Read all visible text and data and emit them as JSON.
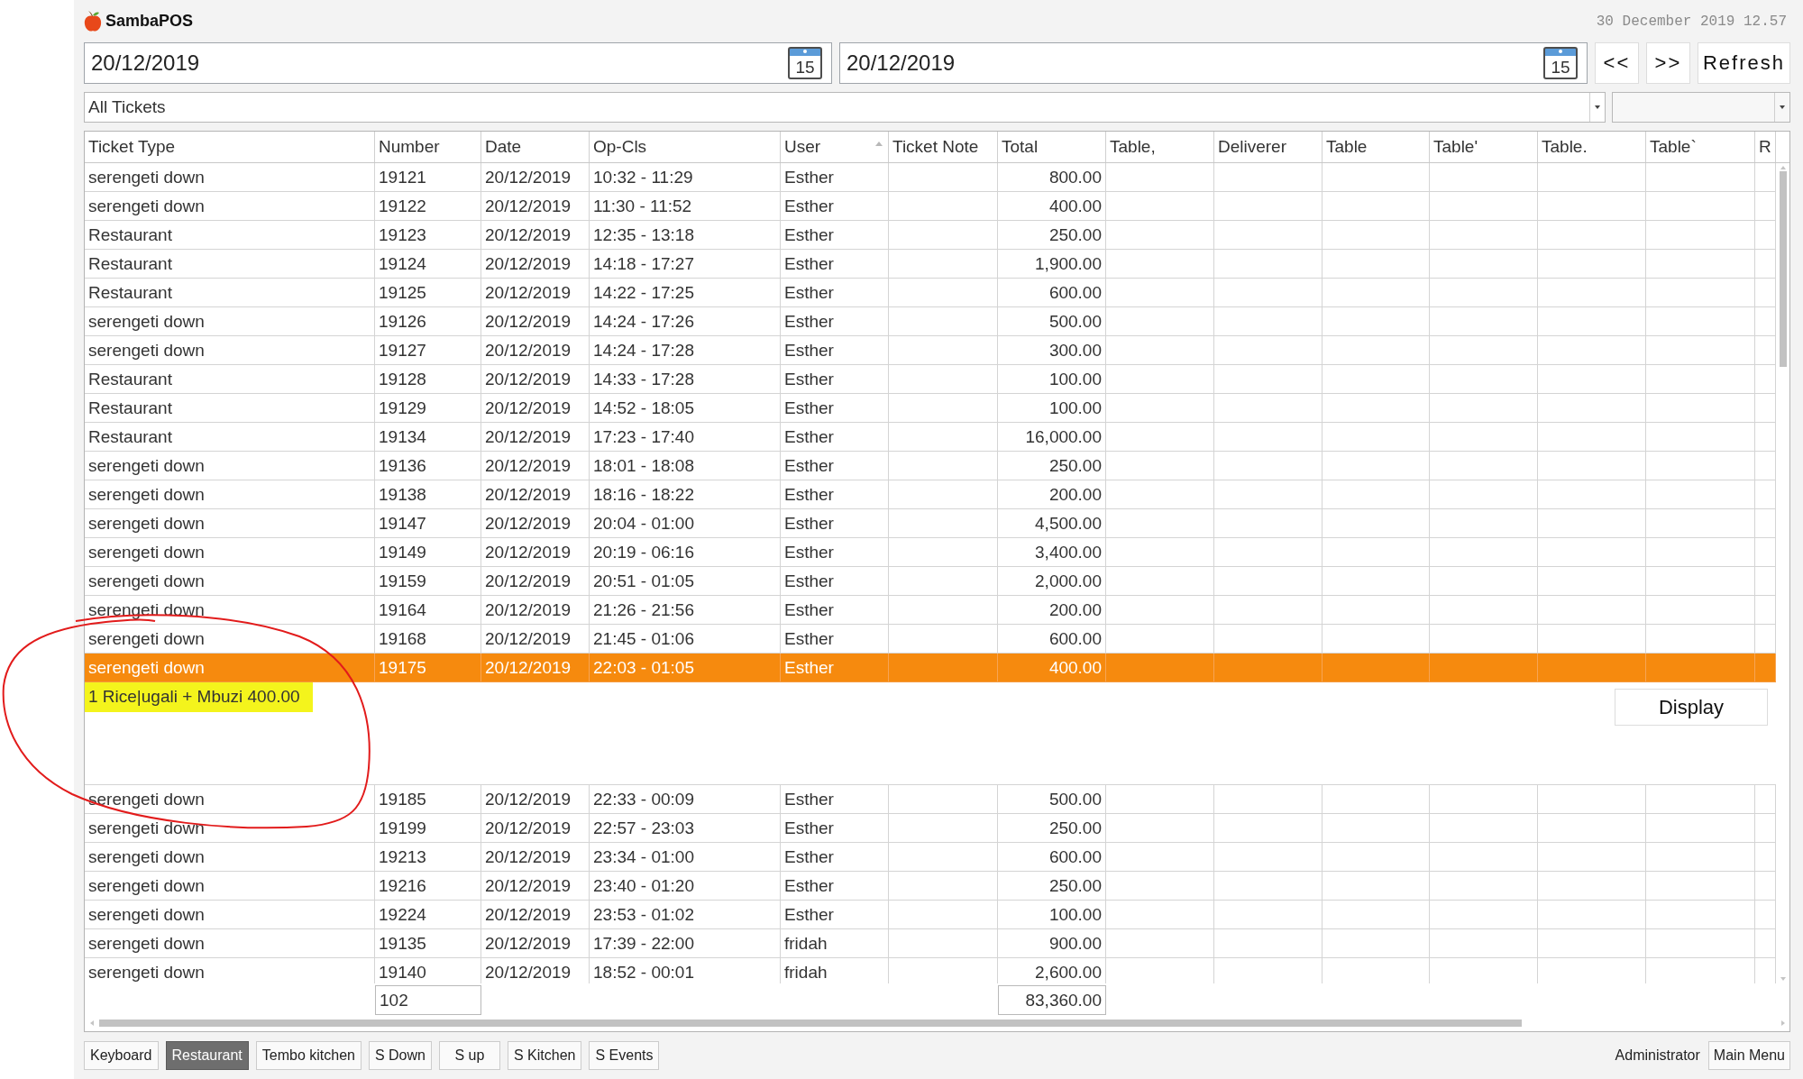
{
  "app": {
    "name": "SambaPOS",
    "clock": "30 December 2019 12.57"
  },
  "date_fields": [
    {
      "value": "20/12/2019",
      "calendar_label": "15"
    },
    {
      "value": "20/12/2019",
      "calendar_label": "15"
    }
  ],
  "nav_buttons": [
    {
      "label": "<<"
    },
    {
      "label": ">>"
    },
    {
      "label": "Refresh"
    }
  ],
  "ticket_filter": {
    "value": "All Tickets"
  },
  "table": {
    "columns": [
      {
        "label": "Ticket Type",
        "sorted": false
      },
      {
        "label": "Number",
        "sorted": false
      },
      {
        "label": "Date",
        "sorted": false
      },
      {
        "label": "Op-Cls",
        "sorted": false
      },
      {
        "label": "User",
        "sorted": true
      },
      {
        "label": "Ticket Note",
        "sorted": false
      },
      {
        "label": "Total",
        "sorted": false
      },
      {
        "label": "Table,",
        "sorted": false
      },
      {
        "label": "Deliverer",
        "sorted": false
      },
      {
        "label": "Table",
        "sorted": false
      },
      {
        "label": "Table'",
        "sorted": false
      },
      {
        "label": "Table.",
        "sorted": false
      },
      {
        "label": "Table`",
        "sorted": false
      },
      {
        "label": "R",
        "sorted": false
      }
    ],
    "rows": [
      {
        "ticket_type": "serengeti down",
        "number": "19121",
        "date": "20/12/2019",
        "op_cls": "10:32 - 11:29",
        "user": "Esther",
        "total": "800.00",
        "selected": false
      },
      {
        "ticket_type": "serengeti down",
        "number": "19122",
        "date": "20/12/2019",
        "op_cls": "11:30 - 11:52",
        "user": "Esther",
        "total": "400.00",
        "selected": false
      },
      {
        "ticket_type": "Restaurant",
        "number": "19123",
        "date": "20/12/2019",
        "op_cls": "12:35 - 13:18",
        "user": "Esther",
        "total": "250.00",
        "selected": false
      },
      {
        "ticket_type": "Restaurant",
        "number": "19124",
        "date": "20/12/2019",
        "op_cls": "14:18 - 17:27",
        "user": "Esther",
        "total": "1,900.00",
        "selected": false
      },
      {
        "ticket_type": "Restaurant",
        "number": "19125",
        "date": "20/12/2019",
        "op_cls": "14:22 - 17:25",
        "user": "Esther",
        "total": "600.00",
        "selected": false
      },
      {
        "ticket_type": "serengeti down",
        "number": "19126",
        "date": "20/12/2019",
        "op_cls": "14:24 - 17:26",
        "user": "Esther",
        "total": "500.00",
        "selected": false
      },
      {
        "ticket_type": "serengeti down",
        "number": "19127",
        "date": "20/12/2019",
        "op_cls": "14:24 - 17:28",
        "user": "Esther",
        "total": "300.00",
        "selected": false
      },
      {
        "ticket_type": "Restaurant",
        "number": "19128",
        "date": "20/12/2019",
        "op_cls": "14:33 - 17:28",
        "user": "Esther",
        "total": "100.00",
        "selected": false
      },
      {
        "ticket_type": "Restaurant",
        "number": "19129",
        "date": "20/12/2019",
        "op_cls": "14:52 - 18:05",
        "user": "Esther",
        "total": "100.00",
        "selected": false
      },
      {
        "ticket_type": "Restaurant",
        "number": "19134",
        "date": "20/12/2019",
        "op_cls": "17:23 - 17:40",
        "user": "Esther",
        "total": "16,000.00",
        "selected": false
      },
      {
        "ticket_type": "serengeti down",
        "number": "19136",
        "date": "20/12/2019",
        "op_cls": "18:01 - 18:08",
        "user": "Esther",
        "total": "250.00",
        "selected": false
      },
      {
        "ticket_type": "serengeti down",
        "number": "19138",
        "date": "20/12/2019",
        "op_cls": "18:16 - 18:22",
        "user": "Esther",
        "total": "200.00",
        "selected": false
      },
      {
        "ticket_type": "serengeti down",
        "number": "19147",
        "date": "20/12/2019",
        "op_cls": "20:04 - 01:00",
        "user": "Esther",
        "total": "4,500.00",
        "selected": false
      },
      {
        "ticket_type": "serengeti down",
        "number": "19149",
        "date": "20/12/2019",
        "op_cls": "20:19 - 06:16",
        "user": "Esther",
        "total": "3,400.00",
        "selected": false
      },
      {
        "ticket_type": "serengeti down",
        "number": "19159",
        "date": "20/12/2019",
        "op_cls": "20:51 - 01:05",
        "user": "Esther",
        "total": "2,000.00",
        "selected": false
      },
      {
        "ticket_type": "serengeti down",
        "number": "19164",
        "date": "20/12/2019",
        "op_cls": "21:26 - 21:56",
        "user": "Esther",
        "total": "200.00",
        "selected": false
      },
      {
        "ticket_type": "serengeti down",
        "number": "19168",
        "date": "20/12/2019",
        "op_cls": "21:45 - 01:06",
        "user": "Esther",
        "total": "600.00",
        "selected": false
      },
      {
        "ticket_type": "serengeti down",
        "number": "19175",
        "date": "20/12/2019",
        "op_cls": "22:03 - 01:05",
        "user": "Esther",
        "total": "400.00",
        "selected": true,
        "detail": {
          "lines": [
            {
              "text": "1 Rice|ugali + Mbuzi 400.00",
              "highlighted": true
            }
          ],
          "button": "Display"
        }
      },
      {
        "ticket_type": "serengeti down",
        "number": "19185",
        "date": "20/12/2019",
        "op_cls": "22:33 - 00:09",
        "user": "Esther",
        "total": "500.00",
        "selected": false
      },
      {
        "ticket_type": "serengeti down",
        "number": "19199",
        "date": "20/12/2019",
        "op_cls": "22:57 - 23:03",
        "user": "Esther",
        "total": "250.00",
        "selected": false
      },
      {
        "ticket_type": "serengeti down",
        "number": "19213",
        "date": "20/12/2019",
        "op_cls": "23:34 - 01:00",
        "user": "Esther",
        "total": "600.00",
        "selected": false
      },
      {
        "ticket_type": "serengeti down",
        "number": "19216",
        "date": "20/12/2019",
        "op_cls": "23:40 - 01:20",
        "user": "Esther",
        "total": "250.00",
        "selected": false
      },
      {
        "ticket_type": "serengeti down",
        "number": "19224",
        "date": "20/12/2019",
        "op_cls": "23:53 - 01:02",
        "user": "Esther",
        "total": "100.00",
        "selected": false
      },
      {
        "ticket_type": "serengeti down",
        "number": "19135",
        "date": "20/12/2019",
        "op_cls": "17:39 - 22:00",
        "user": "fridah",
        "total": "900.00",
        "selected": false
      },
      {
        "ticket_type": "serengeti down",
        "number": "19140",
        "date": "20/12/2019",
        "op_cls": "18:52 - 00:01",
        "user": "fridah",
        "total": "2,600.00",
        "selected": false
      }
    ],
    "totals": {
      "count": "102",
      "total": "83,360.00"
    }
  },
  "bottom_bar": {
    "tabs": [
      {
        "label": "Keyboard",
        "selected": false
      },
      {
        "label": "Restaurant",
        "selected": true
      },
      {
        "label": "Tembo kitchen",
        "selected": false
      },
      {
        "label": "S Down",
        "selected": false
      },
      {
        "label": "S up",
        "selected": false
      },
      {
        "label": "S Kitchen",
        "selected": false
      },
      {
        "label": "S Events",
        "selected": false
      }
    ],
    "user": "Administrator",
    "main_menu": "Main Menu"
  },
  "annotations": [
    {
      "kind": "circle"
    }
  ]
}
